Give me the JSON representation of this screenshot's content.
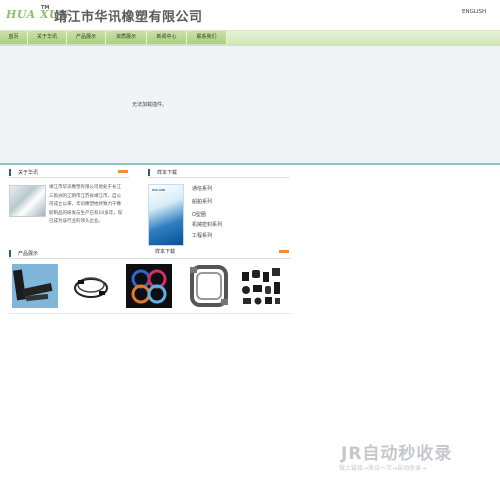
{
  "header": {
    "logo_latin": "HUA XUN",
    "logo_tm": "TM",
    "logo_cn": "靖江市华讯橡塑有限公司",
    "lang_link": "ENGLISH"
  },
  "nav": {
    "items": [
      {
        "label": "首页"
      },
      {
        "label": "关于华讯"
      },
      {
        "label": "产品展示"
      },
      {
        "label": "资质展示"
      },
      {
        "label": "新闻中心"
      },
      {
        "label": "联系我们"
      }
    ]
  },
  "main": {
    "plugin_message": "无法加载插件。"
  },
  "about": {
    "title": "关于华讯",
    "more": "more",
    "text": "靖江市华讯橡塑有限公司地处于长江三角洲的江阴市江苏省靖江市，自公司成立以来，华讯橡塑始终致力于橡胶制品的研发与生产已有10多年，现已成为该行业的领头企业。"
  },
  "samples": {
    "title": "样本下载",
    "cover_brand": "HUA XUN",
    "caption": "样本下载",
    "series": [
      "通信系列",
      "船舶系列",
      "O型圈",
      "机械密封系列",
      "工程系列"
    ]
  },
  "products": {
    "title": "产品展示",
    "more": "more",
    "items": [
      {
        "name": "rubber-strip"
      },
      {
        "name": "cable-ring"
      },
      {
        "name": "o-rings"
      },
      {
        "name": "seal-frame"
      },
      {
        "name": "rubber-parts"
      }
    ]
  },
  "watermark": {
    "main": "JR自动秒收录",
    "sub": "做上链接→来访一次→自动收录→"
  },
  "colors": {
    "nav_green": "#a9cf80",
    "section_mark": "#2e5a8a",
    "teal_divider": "#8cc6c8",
    "more_tag": "#f08c3c"
  }
}
